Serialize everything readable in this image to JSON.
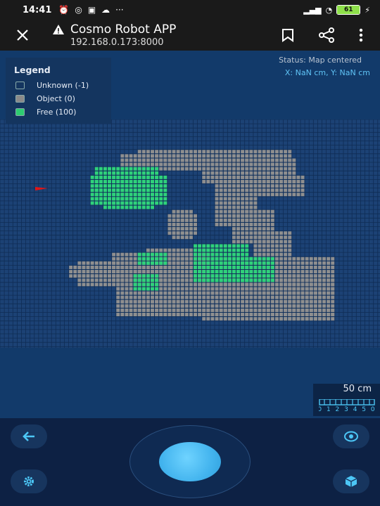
{
  "status_bar": {
    "time": "14:41",
    "battery": "61"
  },
  "app_bar": {
    "title": "Cosmo Robot APP",
    "url": "192.168.0.173:8000"
  },
  "legend": {
    "title": "Legend",
    "items": [
      {
        "label": "Unknown (-1)",
        "color": "#14355f"
      },
      {
        "label": "Object (0)",
        "color": "#8a8a8a"
      },
      {
        "label": "Free (100)",
        "color": "#2ecc71"
      }
    ]
  },
  "map_status": "Status: Map centered",
  "coordinates": "X: NaN cm, Y: NaN cm",
  "scale": {
    "label": "50 cm",
    "ticks": "0 1 2 3 4 5 0"
  },
  "colors": {
    "unknown_cell": "#1c4275",
    "object_cell": "#8f8f8f",
    "free_cell": "#2fd27a",
    "robot_marker": "#e01616",
    "accent": "#4cc6f5"
  }
}
